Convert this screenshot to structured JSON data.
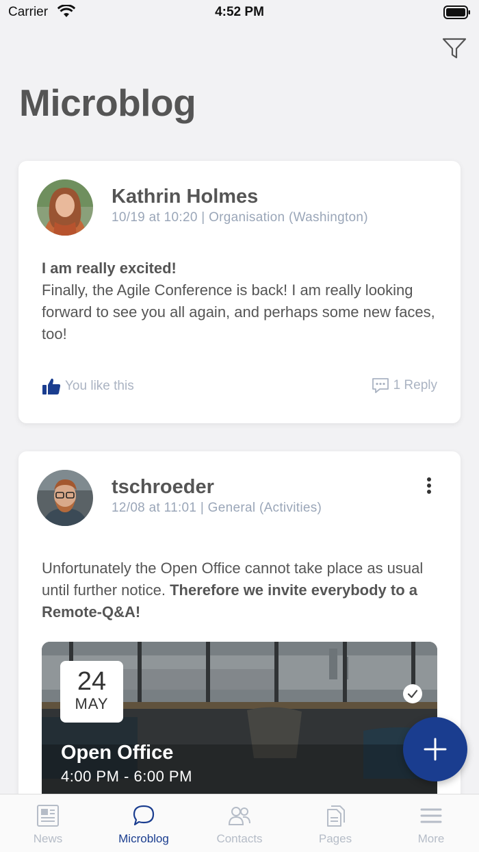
{
  "status_bar": {
    "carrier": "Carrier",
    "time": "4:52 PM"
  },
  "header": {
    "title": "Microblog"
  },
  "posts": [
    {
      "author": "Kathrin Holmes",
      "meta": "10/19 at 10:20 | Organisation (Washington)",
      "headline": "I am really excited!",
      "body": "Finally, the Agile Conference is back! I am really looking forward to see you all again, and perhaps some new faces, too!",
      "like_label": "You like this",
      "reply_label": "1 Reply"
    },
    {
      "author": "tschroeder",
      "meta": "12/08 at 11:01 | General (Activities)",
      "body_plain": "Unfortunately the Open Office cannot take place as usual until further notice.",
      "body_bold": "Therefore we invite everybody to a Remote-Q&A!",
      "event": {
        "day": "24",
        "month": "MAY",
        "title": "Open Office",
        "time": "4:00 PM -  6:00 PM"
      }
    }
  ],
  "tabs": [
    {
      "label": "News",
      "icon": "news-icon"
    },
    {
      "label": "Microblog",
      "icon": "chat-icon"
    },
    {
      "label": "Contacts",
      "icon": "contacts-icon"
    },
    {
      "label": "Pages",
      "icon": "pages-icon"
    },
    {
      "label": "More",
      "icon": "menu-icon"
    }
  ],
  "colors": {
    "accent": "#1a3d8f",
    "muted": "#aab3c2",
    "background": "#f2f2f4"
  }
}
